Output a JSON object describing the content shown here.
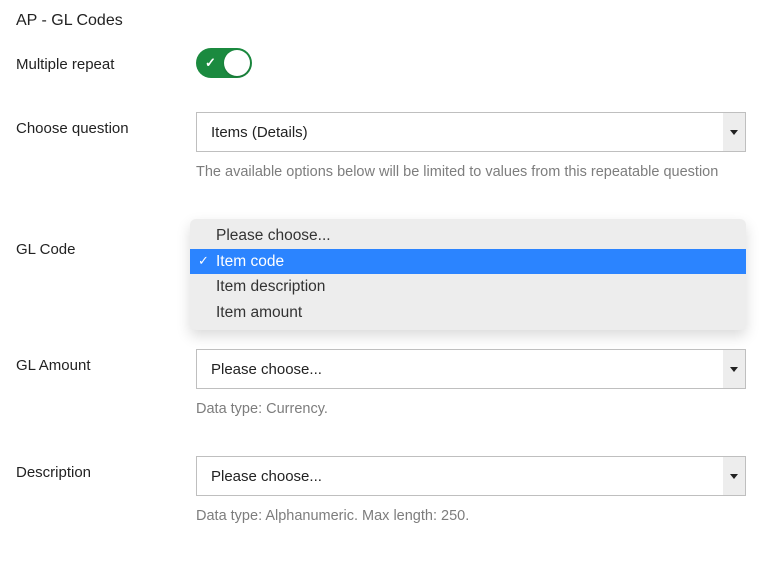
{
  "title": "AP - GL Codes",
  "fields": {
    "multiple_repeat": {
      "label": "Multiple repeat",
      "value": true
    },
    "choose_question": {
      "label": "Choose question",
      "value": "Items (Details)",
      "helper": "The available options below will be limited to values from this repeatable question"
    },
    "gl_code": {
      "label": "GL Code",
      "options": [
        "Please choose...",
        "Item code",
        "Item description",
        "Item amount"
      ],
      "selected": "Item code"
    },
    "gl_amount": {
      "label": "GL Amount",
      "value": "Please choose...",
      "helper": "Data type: Currency."
    },
    "description": {
      "label": "Description",
      "value": "Please choose...",
      "helper": "Data type: Alphanumeric. Max length: 250."
    }
  }
}
